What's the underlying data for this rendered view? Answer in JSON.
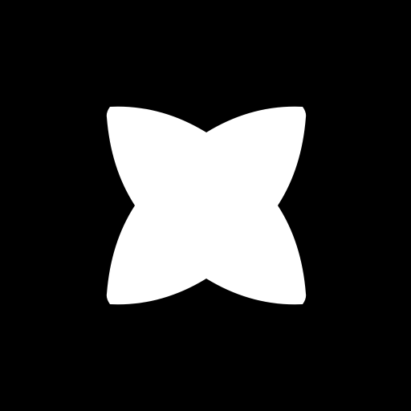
{
  "app": {
    "icon": "four-point-star-icon",
    "colors": {
      "background": "#000000",
      "icon_fill": "#ffffff"
    }
  }
}
